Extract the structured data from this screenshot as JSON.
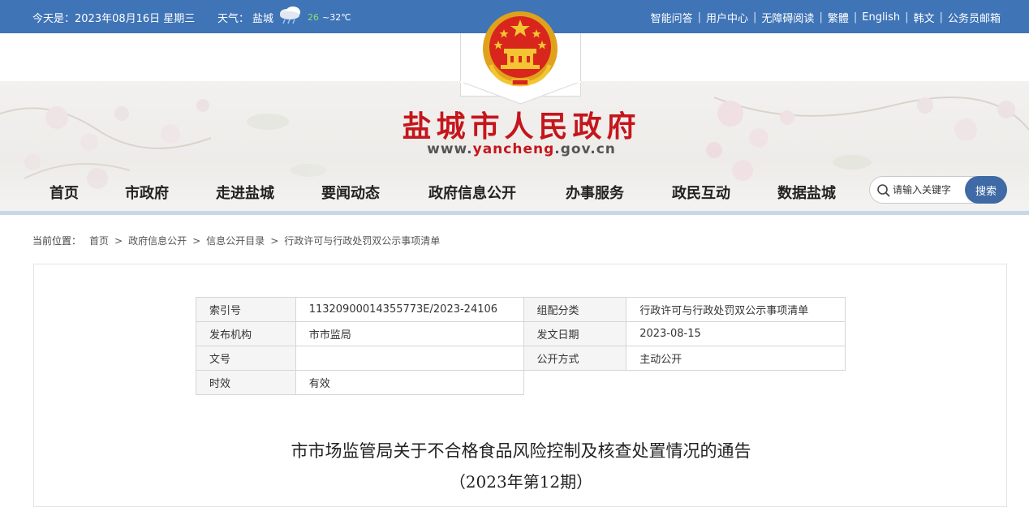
{
  "topbar": {
    "date": "今天是：2023年08月16日 星期三",
    "weather_label": "天气：",
    "city": "盐城",
    "temp_low": "26",
    "temp_high": "~32℃",
    "links": [
      "智能问答",
      "用户中心",
      "无障碍阅读",
      "繁體",
      "English",
      "韩文",
      "公务员邮箱"
    ]
  },
  "header": {
    "title": "盐城市人民政府",
    "domain_prefix": "www.",
    "domain_highlight": "yancheng",
    "domain_suffix": ".gov.cn"
  },
  "nav": {
    "items": [
      "首页",
      "市政府",
      "走进盐城",
      "要闻动态",
      "政府信息公开",
      "办事服务",
      "政民互动",
      "数据盐城"
    ]
  },
  "search": {
    "placeholder": "请输入关键字",
    "button": "搜索"
  },
  "breadcrumb": {
    "label": "当前位置：",
    "items": [
      "首页",
      "政府信息公开",
      "信息公开目录",
      "行政许可与行政处罚双公示事项清单"
    ]
  },
  "meta_table": {
    "rows": [
      [
        "索引号",
        "11320900014355773E/2023-24106",
        "组配分类",
        "行政许可与行政处罚双公示事项清单"
      ],
      [
        "发布机构",
        "市市监局",
        "发文日期",
        "2023-08-15"
      ],
      [
        "文号",
        "",
        "公开方式",
        "主动公开"
      ],
      [
        "时效",
        "有效"
      ]
    ]
  },
  "document": {
    "title": "市市场监管局关于不合格食品风险控制及核查处置情况的通告",
    "subtitle": "（2023年第12期）"
  },
  "colors": {
    "topbar": "#3f74b7",
    "title_red": "#c4161c",
    "search_button": "#3f6aa6",
    "nav_line": "#c8d7ea"
  }
}
